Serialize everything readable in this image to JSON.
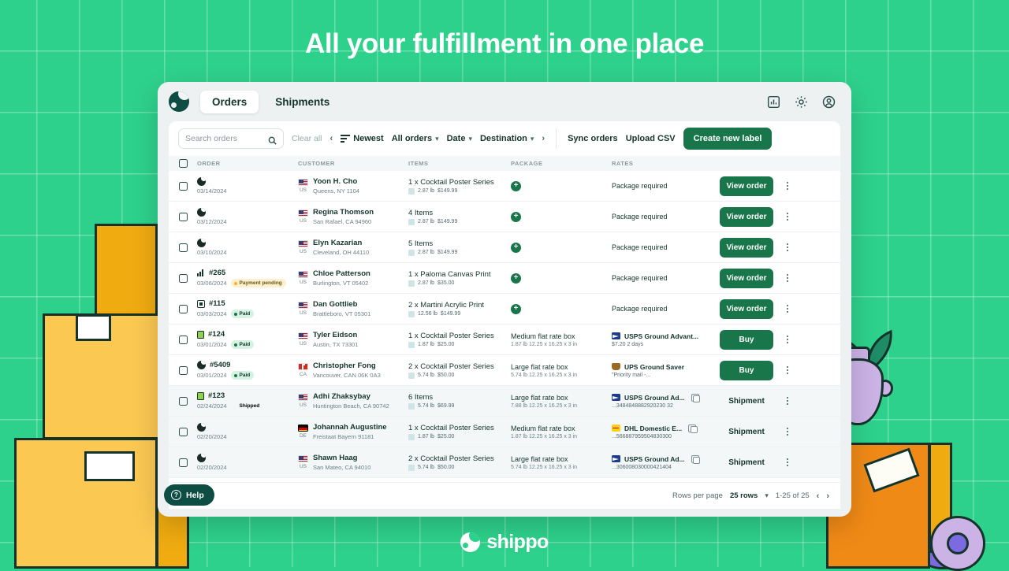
{
  "headline": "All your fulfillment in one place",
  "brand": {
    "name": "shippo",
    "accent": "#2ed18c",
    "primary": "#18764a",
    "dark": "#0e4d43"
  },
  "appbar": {
    "logo": "shippo-globe-icon",
    "tabs": [
      {
        "label": "Orders",
        "active": true
      },
      {
        "label": "Shipments",
        "active": false
      }
    ],
    "icons": [
      "chart-icon",
      "gear-icon",
      "account-icon"
    ]
  },
  "toolbar": {
    "search_placeholder": "Search orders",
    "clear_all": "Clear all",
    "prev_chevron": "‹",
    "next_chevron": "›",
    "sort": "Newest",
    "filter_orders": "All orders",
    "filter_date": "Date",
    "filter_destination": "Destination",
    "sync_orders": "Sync orders",
    "upload_csv": "Upload CSV",
    "create_label": "Create new label"
  },
  "table": {
    "columns": [
      "ORDER",
      "CUSTOMER",
      "ITEMS",
      "PACKAGE",
      "RATES"
    ],
    "rows": [
      {
        "order_icon": "shippo-globe-icon",
        "order_num": "",
        "date": "03/14/2024",
        "badge": null,
        "flag": "us",
        "country": "US",
        "name": "Yoon H. Cho",
        "addr": "Queens, NY 1104",
        "items": "1 x  Cocktail Poster Series",
        "weight": "2.87 lb",
        "price": "$149.99",
        "pkg_type": "add",
        "pkg_name": "",
        "pkg_dim": "",
        "rate_text": "Package required",
        "carrier": null,
        "rate_name": "",
        "rate_sub": "",
        "action": "View order",
        "action_type": "button",
        "alt": false
      },
      {
        "order_icon": "shippo-globe-icon",
        "order_num": "",
        "date": "03/12/2024",
        "badge": null,
        "flag": "us",
        "country": "US",
        "name": "Regina Thomson",
        "addr": "San Rafael, CA 94960",
        "items": "4  Items",
        "weight": "2.87 lb",
        "price": "$149.99",
        "pkg_type": "add",
        "pkg_name": "",
        "pkg_dim": "",
        "rate_text": "Package required",
        "carrier": null,
        "rate_name": "",
        "rate_sub": "",
        "action": "View order",
        "action_type": "button",
        "alt": false
      },
      {
        "order_icon": "shippo-globe-icon",
        "order_num": "",
        "date": "03/10/2024",
        "badge": null,
        "flag": "us",
        "country": "US",
        "name": "Elyn Kazarian",
        "addr": "Cleveland, OH 44110",
        "items": "5  Items",
        "weight": "2.87 lb",
        "price": "$149.99",
        "pkg_type": "add",
        "pkg_name": "",
        "pkg_dim": "",
        "rate_text": "Package required",
        "carrier": null,
        "rate_name": "",
        "rate_sub": "",
        "action": "View order",
        "action_type": "button",
        "alt": false
      },
      {
        "order_icon": "chart-icon",
        "order_num": "#265",
        "date": "03/06/2024",
        "badge": {
          "label": "Payment pending",
          "kind": "pending"
        },
        "flag": "us",
        "country": "US",
        "name": "Chloe Patterson",
        "addr": "Burlington, VT 05402",
        "items": "1 x  Paloma Canvas Print",
        "weight": "2.87 lb",
        "price": "$35.00",
        "pkg_type": "add",
        "pkg_name": "",
        "pkg_dim": "",
        "rate_text": "Package required",
        "carrier": null,
        "rate_name": "",
        "rate_sub": "",
        "action": "View order",
        "action_type": "button",
        "alt": false
      },
      {
        "order_icon": "square-icon",
        "order_num": "#115",
        "date": "03/03/2024",
        "badge": {
          "label": "Paid",
          "kind": "paid"
        },
        "flag": "us",
        "country": "US",
        "name": "Dan Gottlieb",
        "addr": "Brattleboro, VT 05301",
        "items": "2 x  Martini Acrylic Print",
        "weight": "12.56 lb",
        "price": "$149.99",
        "pkg_type": "add",
        "pkg_name": "",
        "pkg_dim": "",
        "rate_text": "Package required",
        "carrier": null,
        "rate_name": "",
        "rate_sub": "",
        "action": "View order",
        "action_type": "button",
        "alt": false
      },
      {
        "order_icon": "bag-icon",
        "order_num": "#124",
        "date": "03/01/2024",
        "badge": {
          "label": "Paid",
          "kind": "paid"
        },
        "flag": "us",
        "country": "US",
        "name": "Tyler Eidson",
        "addr": "Austin, TX 73301",
        "items": "1 x  Cocktail Poster Series",
        "weight": "1.87 lb",
        "price": "$25.00",
        "pkg_type": "box",
        "pkg_name": "Medium flat rate box",
        "pkg_dim": "1.87 lb   12.25 x 16.25 x 3 in",
        "rate_text": "",
        "carrier": "usps",
        "rate_name": "USPS Ground Advant...",
        "rate_sub": "$7.20  2 days",
        "action": "Buy",
        "action_type": "button",
        "alt": false
      },
      {
        "order_icon": "shippo-globe-icon",
        "order_num": "#5409",
        "date": "03/01/2024",
        "badge": {
          "label": "Paid",
          "kind": "paid"
        },
        "flag": "ca",
        "country": "CA",
        "name": "Christopher Fong",
        "addr": "Vancouver, CAN 06K 0A3",
        "items": "2 x  Cocktail Poster Series",
        "weight": "5.74 lb",
        "price": "$50.00",
        "pkg_type": "box",
        "pkg_name": "Large flat rate box",
        "pkg_dim": "5.74 lb   12.25 x 16.25 x 3 in",
        "rate_text": "",
        "carrier": "ups",
        "rate_name": "UPS Ground Saver",
        "rate_sub": "\"Priority mail -...",
        "action": "Buy",
        "action_type": "button",
        "alt": false
      },
      {
        "order_icon": "bag-icon",
        "order_num": "#123",
        "date": "02/24/2024",
        "badge": {
          "label": "Shipped",
          "kind": "shipped"
        },
        "flag": "us",
        "country": "US",
        "name": "Adhi Zhaksybay",
        "addr": "Huntington Beach, CA 90742",
        "items": "6  Items",
        "weight": "5.74 lb",
        "price": "$69.99",
        "pkg_type": "box",
        "pkg_name": "Large flat rate box",
        "pkg_dim": "7.88 lb   12.25 x 16.25 x 3 in",
        "rate_text": "",
        "carrier": "usps",
        "rate_name": "USPS Ground Ad...",
        "rate_sub": "...3484848882920230 32",
        "action": "Shipment",
        "action_type": "link",
        "alt": true
      },
      {
        "order_icon": "shippo-globe-icon",
        "order_num": "",
        "date": "02/20/2024",
        "badge": null,
        "flag": "de",
        "country": "DE",
        "name": "Johannah Augustine",
        "addr": "Freistaat Bayern 91181",
        "items": "1 x  Cocktail Poster Series",
        "weight": "1.87 lb",
        "price": "$25.00",
        "pkg_type": "box",
        "pkg_name": "Medium flat rate box",
        "pkg_dim": "1.87 lb   12.25 x 16.25 x 3 in",
        "rate_text": "",
        "carrier": "dhl",
        "rate_name": "DHL Domestic E...",
        "rate_sub": "...566887959504830300",
        "action": "Shipment",
        "action_type": "link",
        "alt": true
      },
      {
        "order_icon": "shippo-globe-icon",
        "order_num": "",
        "date": "02/20/2024",
        "badge": null,
        "flag": "us",
        "country": "US",
        "name": "Shawn Haag",
        "addr": "San Mateo, CA 94010",
        "items": "2 x  Cocktail Poster Series",
        "weight": "5.74 lb",
        "price": "$50.00",
        "pkg_type": "box",
        "pkg_name": "Large flat rate box",
        "pkg_dim": "5.74 lb   12.25 x 16.25 x 3 in",
        "rate_text": "",
        "carrier": "usps",
        "rate_name": "USPS Ground Ad...",
        "rate_sub": "...306008030000421404",
        "action": "Shipment",
        "action_type": "link",
        "alt": true
      }
    ]
  },
  "footer": {
    "rows_per_page_label": "Rows per page",
    "rows_per_page_value": "25 rows",
    "range": "1-25 of 25",
    "prev": "‹",
    "next": "›"
  },
  "help": {
    "label": "Help",
    "icon": "question-icon"
  }
}
